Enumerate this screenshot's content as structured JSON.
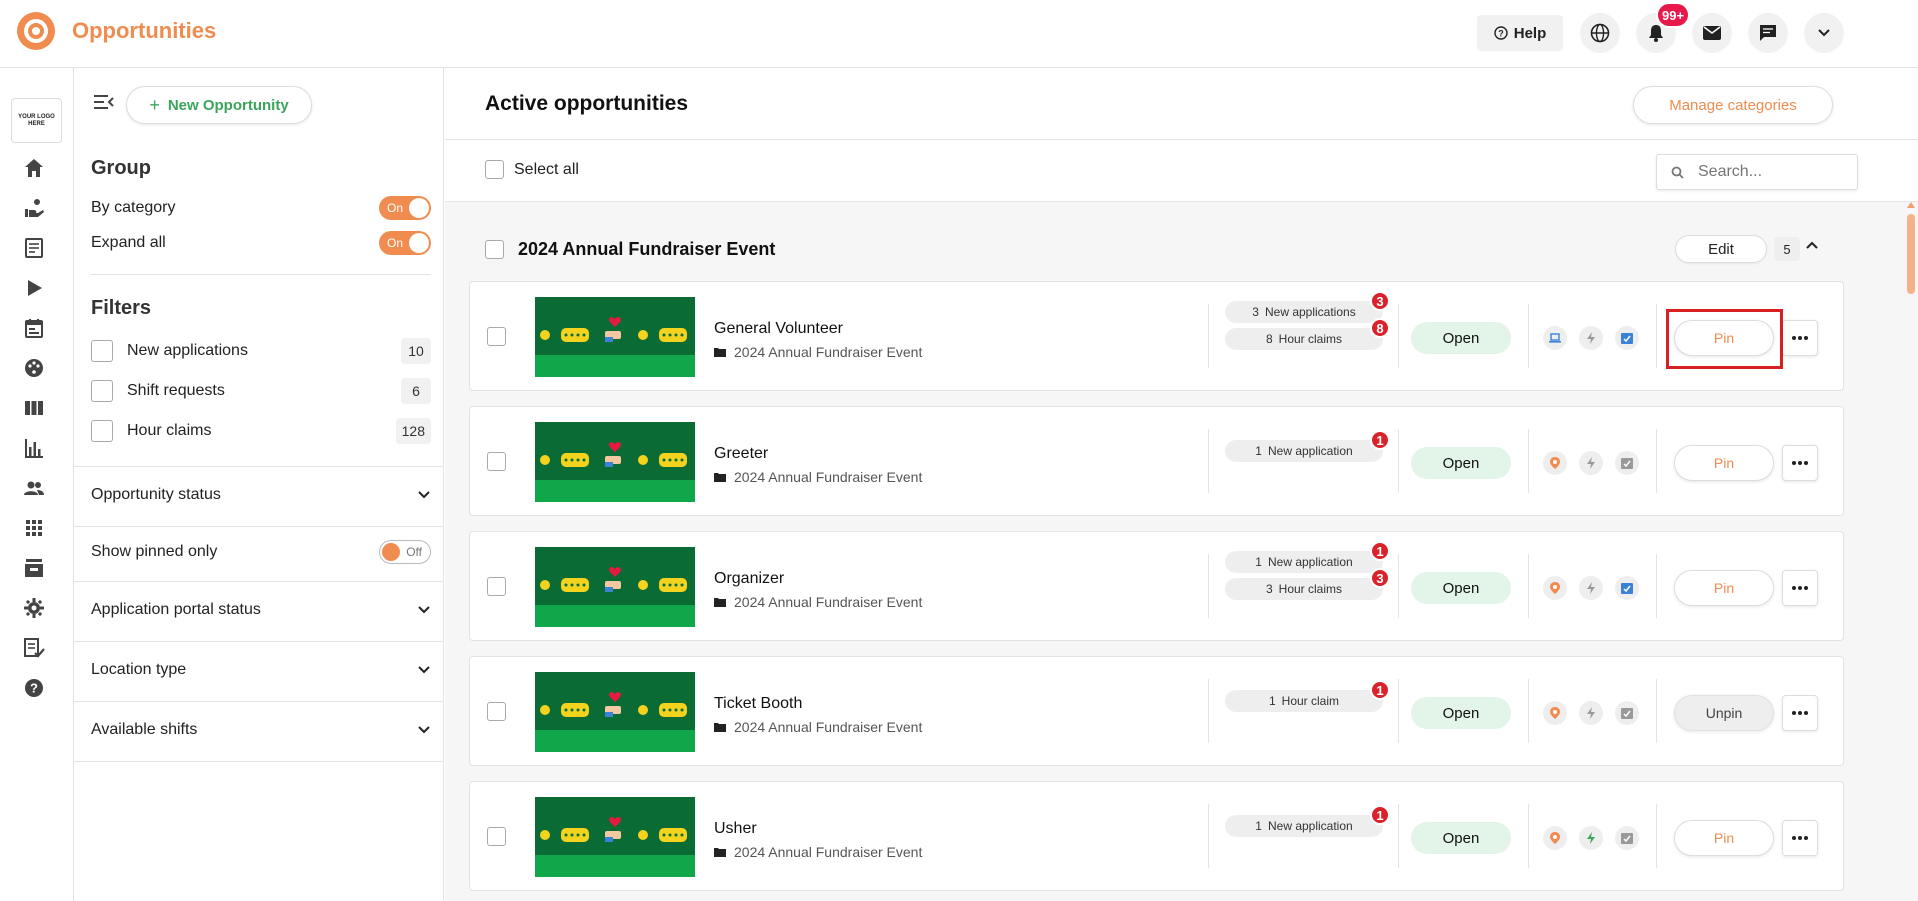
{
  "header": {
    "title": "Opportunities",
    "help_label": "Help",
    "notification_count": "99+"
  },
  "rail": {
    "logo_text": "YOUR LOGO HERE",
    "icons": [
      "home-icon",
      "volunteer-hand-icon",
      "form-icon",
      "play-icon",
      "calendar-icon",
      "palette-icon",
      "board-icon",
      "chart-icon",
      "people-icon",
      "apps-grid-icon",
      "inbox-icon",
      "gear-icon",
      "checklist-icon",
      "help-circle-icon"
    ]
  },
  "panel": {
    "new_opportunity_label": "New Opportunity",
    "group_heading": "Group",
    "by_category_label": "By category",
    "by_category_state": "On",
    "expand_all_label": "Expand all",
    "expand_all_state": "On",
    "filters_heading": "Filters",
    "filters": [
      {
        "label": "New applications",
        "count": "10"
      },
      {
        "label": "Shift requests",
        "count": "6"
      },
      {
        "label": "Hour claims",
        "count": "128"
      }
    ],
    "opportunity_status_label": "Opportunity status",
    "show_pinned_label": "Show pinned only",
    "show_pinned_state": "Off",
    "application_portal_label": "Application portal status",
    "location_type_label": "Location type",
    "available_shifts_label": "Available shifts"
  },
  "main": {
    "title": "Active opportunities",
    "manage_categories_label": "Manage categories",
    "select_all_label": "Select all",
    "search_placeholder": "Search...",
    "group": {
      "title": "2024 Annual Fundraiser Event",
      "edit_label": "Edit",
      "count": "5"
    },
    "opportunities": [
      {
        "title": "General Volunteer",
        "category": "2024 Annual Fundraiser Event",
        "stats": [
          {
            "count": "3",
            "label": "New applications",
            "badge": "3"
          },
          {
            "count": "8",
            "label": "Hour claims",
            "badge": "8"
          }
        ],
        "status": "Open",
        "pin_label": "Pin"
      },
      {
        "title": "Greeter",
        "category": "2024 Annual Fundraiser Event",
        "stats": [
          {
            "count": "1",
            "label": "New application",
            "badge": "1"
          }
        ],
        "status": "Open",
        "pin_label": "Pin"
      },
      {
        "title": "Organizer",
        "category": "2024 Annual Fundraiser Event",
        "stats": [
          {
            "count": "1",
            "label": "New application",
            "badge": "1"
          },
          {
            "count": "3",
            "label": "Hour claims",
            "badge": "3"
          }
        ],
        "status": "Open",
        "pin_label": "Pin"
      },
      {
        "title": "Ticket Booth",
        "category": "2024 Annual Fundraiser Event",
        "stats": [
          {
            "count": "1",
            "label": "Hour claim",
            "badge": "1"
          }
        ],
        "status": "Open",
        "pin_label": "Unpin"
      },
      {
        "title": "Usher",
        "category": "2024 Annual Fundraiser Event",
        "stats": [
          {
            "count": "1",
            "label": "New application",
            "badge": "1"
          }
        ],
        "status": "Open",
        "pin_label": "Pin"
      }
    ]
  },
  "colors": {
    "brand": "#f08c4f",
    "accent_green": "#3aa55b",
    "badge_red": "#d9222a",
    "highlight_red": "#d82023"
  }
}
